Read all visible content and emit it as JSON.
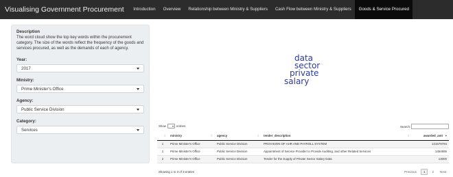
{
  "navbar": {
    "brand": "Visualising Government Procurement",
    "tabs": [
      {
        "label": "Introduction"
      },
      {
        "label": "Overview"
      },
      {
        "label": "Relationship between Ministry & Suppliers"
      },
      {
        "label": "Cash Flow between Ministry & Suppliers"
      },
      {
        "label": "Goods & Service Procured",
        "active": true
      }
    ]
  },
  "sidebar": {
    "description_title": "Description",
    "description_body": "The word cloud show the top key words within the procurement category. The size of the words reflect the frequency of the goods and services procured, as well as the demands of each of agency.",
    "year": {
      "label": "Year:",
      "value": "2017"
    },
    "ministry": {
      "label": "Ministry:",
      "value": "Prime Minister's Office"
    },
    "agency": {
      "label": "Agency:",
      "value": "Public Service Division"
    },
    "category": {
      "label": "Category:",
      "value": "Services"
    }
  },
  "wordcloud": {
    "words": [
      "data",
      "sector",
      "private",
      "salary"
    ],
    "color": "#2b3a99"
  },
  "table": {
    "show_label": "Show",
    "length_value": "10",
    "entries_label": "entries",
    "search_label": "Search:",
    "search_value": "",
    "columns": [
      "",
      "ministry",
      "agency",
      "tender_description",
      "awarded_amt"
    ],
    "rows": [
      [
        "1",
        "Prime Minister's Office",
        "Public Service Division",
        "PROVISION OF AHR AND PAYROLL SYSTEM",
        "121579794"
      ],
      [
        "1",
        "Prime Minister's Office",
        "Public Service Division",
        "Appointment of Service Provider to Provide Auditing, and other Related Services",
        "1454555"
      ],
      [
        "2",
        "Prime Minister's Office",
        "Public Service Division",
        "Tender for the Supply of Private Sector Salary Data",
        "13000"
      ]
    ],
    "info": "Showing 1 to 3 of 3 entries",
    "pagination": {
      "previous": "Previous",
      "pages": [
        "1",
        "2"
      ],
      "current": "1",
      "next": "Next"
    }
  }
}
